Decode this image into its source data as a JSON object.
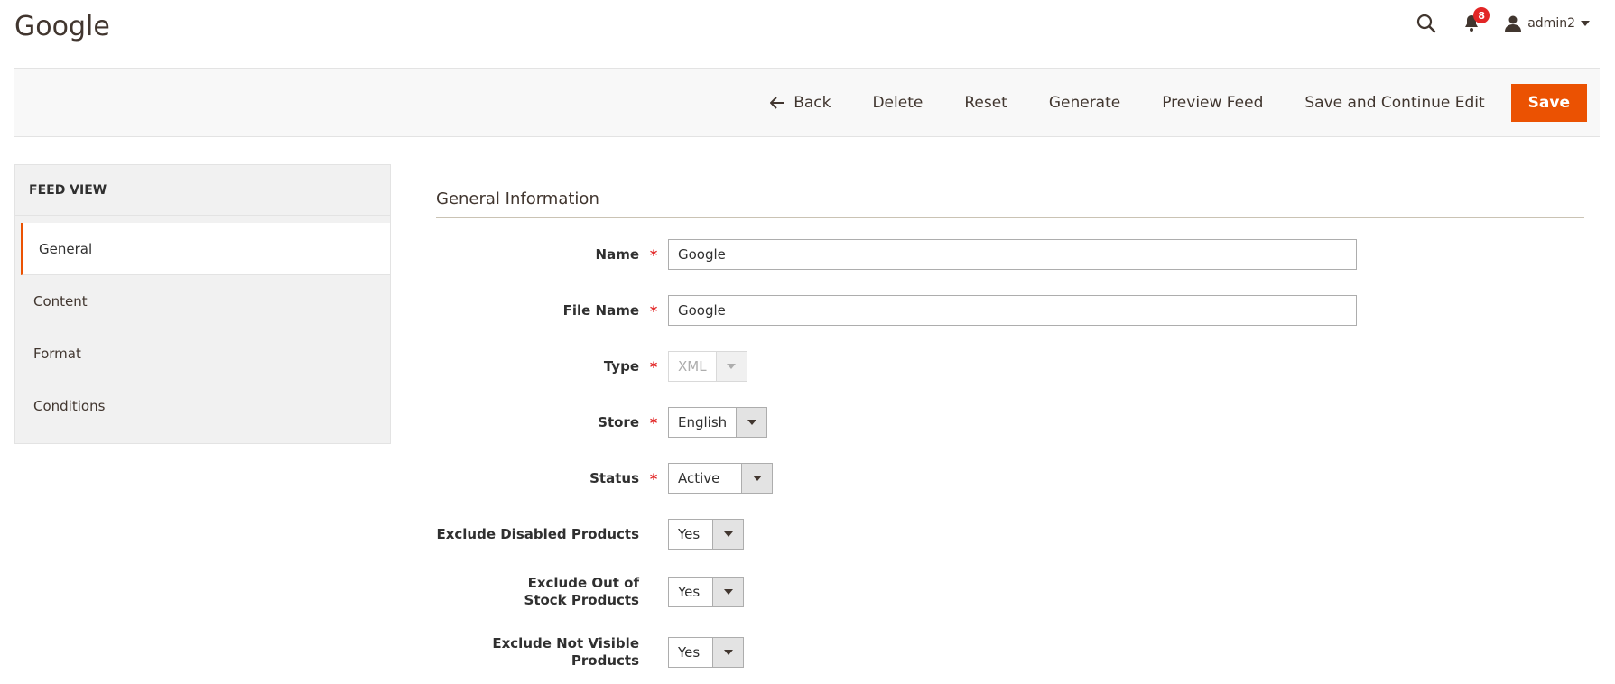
{
  "header": {
    "title": "Google",
    "notifications_count": "8",
    "user_name": "admin2"
  },
  "actions": {
    "back": "Back",
    "delete": "Delete",
    "reset": "Reset",
    "generate": "Generate",
    "preview_feed": "Preview Feed",
    "save_continue": "Save and Continue Edit",
    "save": "Save"
  },
  "sidebar": {
    "title": "FEED VIEW",
    "items": [
      {
        "label": "General"
      },
      {
        "label": "Content"
      },
      {
        "label": "Format"
      },
      {
        "label": "Conditions"
      }
    ]
  },
  "section": {
    "title": "General Information"
  },
  "fields": {
    "name": {
      "label": "Name",
      "value": "Google"
    },
    "file_name": {
      "label": "File Name",
      "value": "Google"
    },
    "type": {
      "label": "Type",
      "value": "XML"
    },
    "store": {
      "label": "Store",
      "value": "English"
    },
    "status": {
      "label": "Status",
      "value": "Active"
    },
    "exclude_disabled": {
      "label": "Exclude Disabled Products",
      "value": "Yes"
    },
    "exclude_out_of_stock": {
      "label": "Exclude Out of Stock Products",
      "value": "Yes"
    },
    "exclude_not_visible": {
      "label": "Exclude Not Visible Products",
      "value": "Yes"
    }
  },
  "colors": {
    "accent": "#eb5202",
    "required": "#e22626"
  },
  "icons": [
    "search-icon",
    "bell-icon",
    "user-icon",
    "chevron-down-icon",
    "arrow-left-icon"
  ]
}
